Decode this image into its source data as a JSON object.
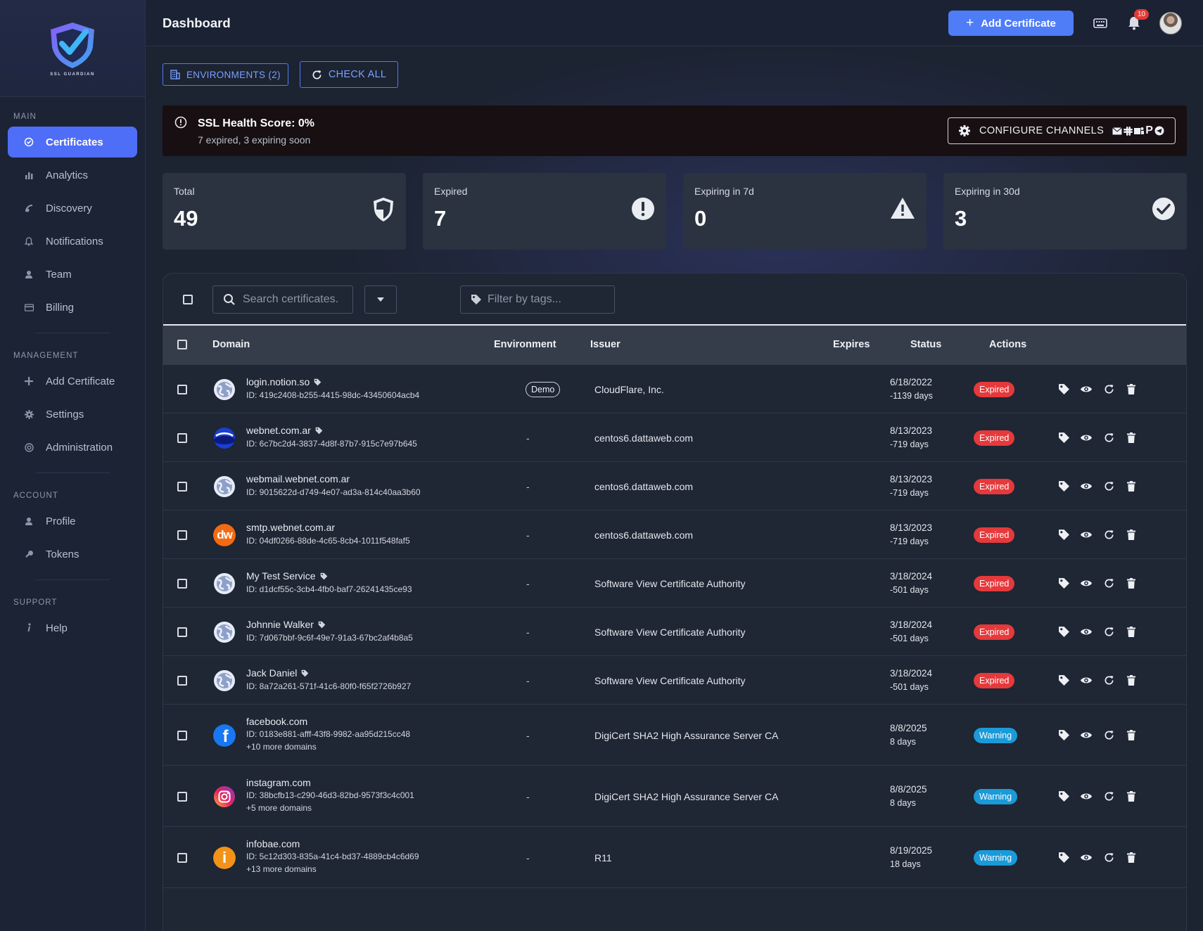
{
  "app": {
    "name": "SSL GUARDIAN"
  },
  "sidebar": {
    "sections": [
      {
        "title": "MAIN",
        "items": [
          {
            "label": "Certificates",
            "icon": "certificate-icon",
            "active": true
          },
          {
            "label": "Analytics",
            "icon": "bar-chart-icon"
          },
          {
            "label": "Discovery",
            "icon": "radar-icon"
          },
          {
            "label": "Notifications",
            "icon": "bell-icon"
          },
          {
            "label": "Team",
            "icon": "person-icon"
          },
          {
            "label": "Billing",
            "icon": "card-icon"
          }
        ]
      },
      {
        "title": "MANAGEMENT",
        "items": [
          {
            "label": "Add Certificate",
            "icon": "plus-icon"
          },
          {
            "label": "Settings",
            "icon": "gear-icon"
          },
          {
            "label": "Administration",
            "icon": "admin-icon"
          }
        ]
      },
      {
        "title": "ACCOUNT",
        "items": [
          {
            "label": "Profile",
            "icon": "person-icon"
          },
          {
            "label": "Tokens",
            "icon": "key-icon"
          }
        ]
      },
      {
        "title": "SUPPORT",
        "items": [
          {
            "label": "Help",
            "icon": "info-icon"
          }
        ]
      }
    ]
  },
  "header": {
    "title": "Dashboard",
    "add_label": "Add Certificate",
    "notification_count": "10"
  },
  "toolbar": {
    "environments_label": "ENVIRONMENTS (2)",
    "check_all_label": "CHECK ALL"
  },
  "health": {
    "title": "SSL Health Score: 0%",
    "subtitle": "7 expired, 3 expiring soon",
    "configure_label": "CONFIGURE CHANNELS",
    "channel_p": "P"
  },
  "stats": [
    {
      "label": "Total",
      "value": "49",
      "icon": "shield-icon"
    },
    {
      "label": "Expired",
      "value": "7",
      "icon": "exclamation-circle-icon"
    },
    {
      "label": "Expiring in 7d",
      "value": "0",
      "icon": "warning-triangle-icon"
    },
    {
      "label": "Expiring in 30d",
      "value": "3",
      "icon": "check-circle-icon"
    }
  ],
  "filters": {
    "search_placeholder": "Search certificates.",
    "tags_placeholder": "Filter by tags..."
  },
  "table": {
    "columns": [
      "Domain",
      "Environment",
      "Issuer",
      "Expires",
      "Status",
      "Actions"
    ],
    "rows": [
      {
        "domain": "login.notion.so",
        "tag": true,
        "id": "ID: 419c2408-b255-4415-98dc-43450604acb4",
        "more": "",
        "env": "Demo",
        "issuer": "CloudFlare, Inc.",
        "expires": "6/18/2022",
        "days": "-1139 days",
        "status": "Expired",
        "favicon": "globe"
      },
      {
        "domain": "webnet.com.ar",
        "tag": true,
        "id": "ID: 6c7bc2d4-3837-4d8f-87b7-915c7e97b645",
        "more": "",
        "env": "-",
        "issuer": "centos6.dattaweb.com",
        "expires": "8/13/2023",
        "days": "-719 days",
        "status": "Expired",
        "favicon": "webnet"
      },
      {
        "domain": "webmail.webnet.com.ar",
        "tag": false,
        "id": "ID: 9015622d-d749-4e07-ad3a-814c40aa3b60",
        "more": "",
        "env": "-",
        "issuer": "centos6.dattaweb.com",
        "expires": "8/13/2023",
        "days": "-719 days",
        "status": "Expired",
        "favicon": "globe"
      },
      {
        "domain": "smtp.webnet.com.ar",
        "tag": false,
        "id": "ID: 04df0266-88de-4c65-8cb4-1011f548faf5",
        "more": "",
        "env": "-",
        "issuer": "centos6.dattaweb.com",
        "expires": "8/13/2023",
        "days": "-719 days",
        "status": "Expired",
        "favicon": "dw",
        "favicon_text": "dw"
      },
      {
        "domain": "My Test Service",
        "tag": true,
        "id": "ID: d1dcf55c-3cb4-4fb0-baf7-26241435ce93",
        "more": "",
        "env": "-",
        "issuer": "Software View Certificate Authority",
        "expires": "3/18/2024",
        "days": "-501 days",
        "status": "Expired",
        "favicon": "globe"
      },
      {
        "domain": "Johnnie Walker",
        "tag": true,
        "id": "ID: 7d067bbf-9c6f-49e7-91a3-67bc2af4b8a5",
        "more": "",
        "env": "-",
        "issuer": "Software View Certificate Authority",
        "expires": "3/18/2024",
        "days": "-501 days",
        "status": "Expired",
        "favicon": "globe"
      },
      {
        "domain": "Jack Daniel",
        "tag": true,
        "id": "ID: 8a72a261-571f-41c6-80f0-f65f2726b927",
        "more": "",
        "env": "-",
        "issuer": "Software View Certificate Authority",
        "expires": "3/18/2024",
        "days": "-501 days",
        "status": "Expired",
        "favicon": "globe"
      },
      {
        "domain": "facebook.com",
        "tag": false,
        "id": "ID: 0183e881-afff-43f8-9982-aa95d215cc48",
        "more": "+10 more domains",
        "env": "-",
        "issuer": "DigiCert SHA2 High Assurance Server CA",
        "expires": "8/8/2025",
        "days": "8 days",
        "status": "Warning",
        "favicon": "facebook",
        "favicon_text": "f"
      },
      {
        "domain": "instagram.com",
        "tag": false,
        "id": "ID: 38bcfb13-c290-46d3-82bd-9573f3c4c001",
        "more": "+5 more domains",
        "env": "-",
        "issuer": "DigiCert SHA2 High Assurance Server CA",
        "expires": "8/8/2025",
        "days": "8 days",
        "status": "Warning",
        "favicon": "instagram"
      },
      {
        "domain": "infobae.com",
        "tag": false,
        "id": "ID: 5c12d303-835a-41c4-bd37-4889cb4c6d69",
        "more": "+13 more domains",
        "env": "-",
        "issuer": "R11",
        "expires": "8/19/2025",
        "days": "18 days",
        "status": "Warning",
        "favicon": "infobae",
        "favicon_text": "i"
      }
    ]
  }
}
